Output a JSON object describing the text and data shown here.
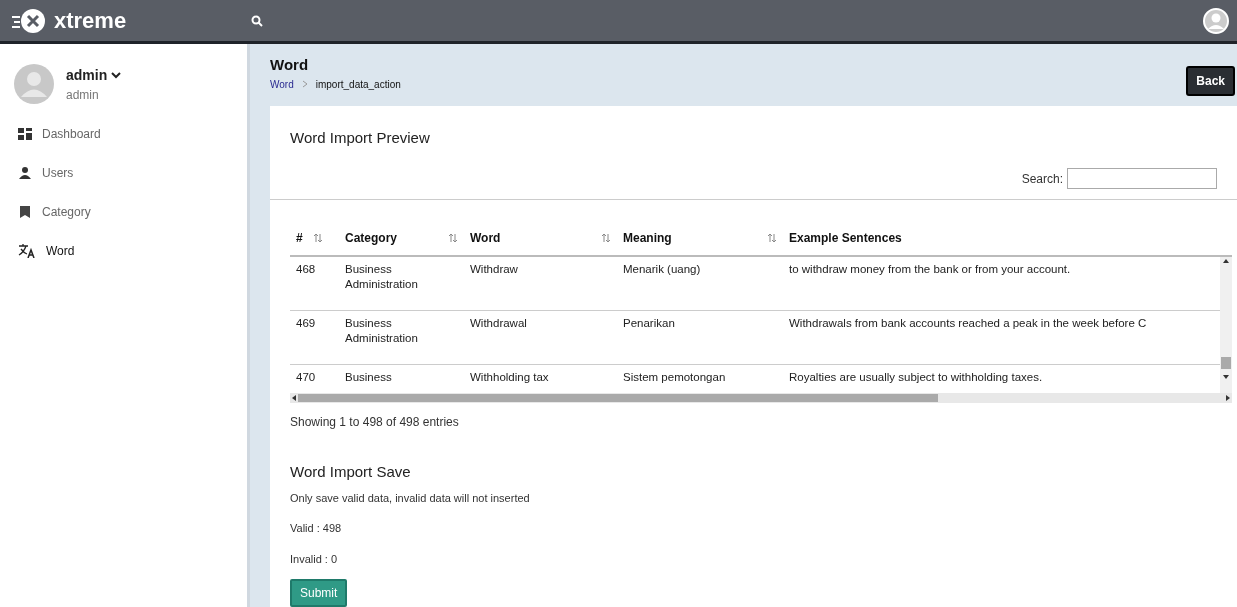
{
  "topbar": {
    "brand": "xtreme"
  },
  "user": {
    "name": "admin",
    "role": "admin"
  },
  "sidebar": {
    "items": [
      {
        "kind": "dashboard",
        "label": "Dashboard",
        "selected": false
      },
      {
        "kind": "users",
        "label": "Users",
        "selected": false
      },
      {
        "kind": "category",
        "label": "Category",
        "selected": false
      },
      {
        "kind": "word",
        "label": "Word",
        "selected": true
      }
    ]
  },
  "page": {
    "title": "Word",
    "breadcrumb": [
      "Word",
      "import_data_action"
    ],
    "back_button": "Back"
  },
  "preview": {
    "title": "Word Import Preview",
    "search_label": "Search:",
    "table": {
      "columns": [
        {
          "label": "#",
          "sortable": true
        },
        {
          "label": "Category",
          "sortable": true
        },
        {
          "label": "Word",
          "sortable": true
        },
        {
          "label": "Meaning",
          "sortable": true
        },
        {
          "label": "Example Sentences",
          "sortable": false
        }
      ],
      "rows": [
        [
          "468",
          "Business Administration",
          "Withdraw",
          "Menarik (uang)",
          "to withdraw money from the bank or from your account."
        ],
        [
          "469",
          "Business Administration",
          "Withdrawal",
          "Penarikan",
          "Withdrawals from bank accounts reached a peak in the week before C"
        ],
        [
          "470",
          "Business",
          "Withholding tax",
          "Sistem pemotongan",
          "Royalties are usually subject to withholding taxes."
        ]
      ]
    },
    "info": "Showing 1 to 498 of 498 entries"
  },
  "save": {
    "title": "Word Import Save",
    "note": "Only save valid data, invalid data will not inserted",
    "valid": "Valid : 498",
    "invalid": "Invalid : 0",
    "submit_button": "Submit"
  }
}
